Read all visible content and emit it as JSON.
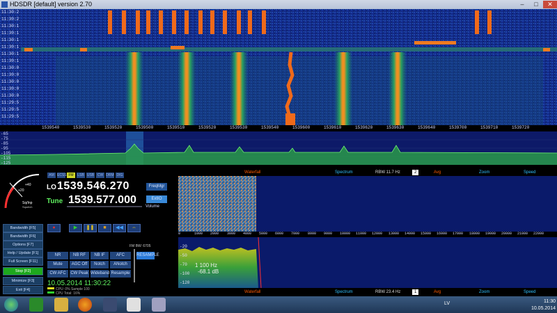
{
  "window": {
    "title": "HDSDR [default] version 2.70",
    "min": "–",
    "max": "□",
    "close": "✕"
  },
  "waterfall_top": {
    "time_labels": [
      "11:30:2",
      "11:30:2",
      "11:30:1",
      "11:30:1",
      "11:30:1",
      "11:30:1",
      "11:30:1",
      "11:30:1",
      "11:30:0",
      "11:30:0",
      "11:30:0",
      "11:30:0",
      "11:30:0",
      "11:29:5",
      "11:29:5",
      "11:29:5"
    ],
    "freq_labels": [
      "1539540",
      "1539530",
      "1539520",
      "1539500",
      "1539510",
      "1539520",
      "1539530",
      "1539540",
      "1539600",
      "1539610",
      "1539620",
      "1539630",
      "1539640",
      "1539700",
      "1539710",
      "1539720"
    ]
  },
  "spectrum_top": {
    "db_labels": [
      "-65",
      "-75",
      "-85",
      "-95",
      "-105",
      "-115",
      "-125"
    ]
  },
  "smeter": {
    "labels": [
      "+40",
      "+20",
      "S9"
    ],
    "unit": "Sq/Inp",
    "sublabel": "Squelch"
  },
  "modes": [
    "AM",
    "ECSS",
    "FM",
    "LSB",
    "USB",
    "CW",
    "DRM",
    "DIG"
  ],
  "lo": {
    "label": "LO",
    "value": "1539.546.270"
  },
  "tune": {
    "label": "Tune",
    "value": "1539.577.000"
  },
  "buttons": {
    "freqmgr": "FreqMgr",
    "extio": "ExtIO",
    "volume": "Volume"
  },
  "side_buttons": [
    "Bandwidth [F5]",
    "Bandwidth [F6]",
    "Options [F7]",
    "Help / Update [F1]",
    "Full Screen [F11]",
    "Stop [F2]",
    "Minimize [F3]",
    "Exit [F4]"
  ],
  "dsp_buttons": [
    "NR",
    "NB RF",
    "NB IF",
    "AFC",
    "Mute",
    "AGC Off",
    "Notch",
    "ANotch",
    "CW AFC",
    "CW Peak",
    "Wideband",
    "Resample"
  ],
  "filter": {
    "label": "FM BW: 6705",
    "mode": "RESAMPLE"
  },
  "status": {
    "datetime": "10.05.2014 11:30:22",
    "cpu1": "CPU: 0% Sample 100",
    "cpu2": "CPU Total: 16%"
  },
  "ctrl_bar": {
    "waterfall": "Waterfall",
    "spectrum": "Spectrum",
    "rbw": "RBW 11.7 Hz",
    "avg_val": "2",
    "avg": "Avg",
    "zoom": "Zoom",
    "speed": "Speed"
  },
  "ctrl_bar2": {
    "waterfall": "Waterfall",
    "spectrum": "Spectrum",
    "rbw": "RBW 23.4 Hz",
    "avg_val": "1",
    "avg": "Avg",
    "zoom": "Zoom",
    "speed": "Speed"
  },
  "audio_axis": [
    "0",
    "1000",
    "2000",
    "3000",
    "4000",
    "5000",
    "6000",
    "7000",
    "8000",
    "9000",
    "10000",
    "11000",
    "12000",
    "13000",
    "14000",
    "15000",
    "16000",
    "17000",
    "18000",
    "19000",
    "20000",
    "21000",
    "22000"
  ],
  "audio_db": [
    "-20",
    "-50",
    "-70",
    "-100",
    "-120"
  ],
  "cursor": {
    "hz": "1 100 Hz",
    "db": "-68.1 dB"
  },
  "taskbar": {
    "lang": "LV",
    "time": "11:30",
    "date": "10.05.2014"
  }
}
